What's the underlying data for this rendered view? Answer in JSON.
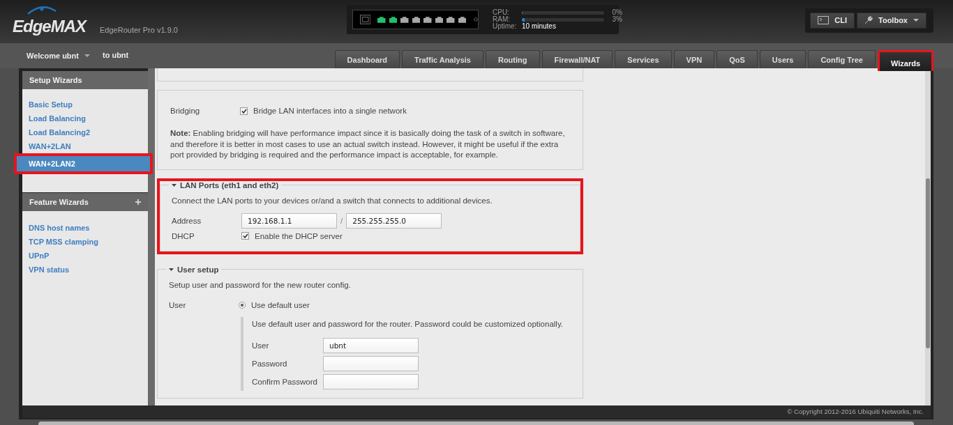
{
  "header": {
    "logo": "EdgeMAX",
    "product": "EdgeRouter Pro v1.9.0"
  },
  "ports": [
    {
      "active": true
    },
    {
      "active": true
    },
    {
      "active": false
    },
    {
      "active": false
    },
    {
      "active": false
    },
    {
      "active": false
    },
    {
      "active": false
    },
    {
      "active": false
    }
  ],
  "stats": [
    {
      "label": "CPU:",
      "level": 0,
      "reading": "0%"
    },
    {
      "label": "RAM:",
      "level": 0.03,
      "reading": "3%"
    }
  ],
  "uptime": {
    "label": "Uptime:",
    "value": "10 minutes"
  },
  "tools": [
    {
      "kind": "terminal",
      "label": "CLI",
      "dropdown": false
    },
    {
      "kind": "wrench",
      "label": "Toolbox",
      "dropdown": true
    }
  ],
  "user_menu": {
    "label": "Welcome ubnt",
    "target": "to ubnt"
  },
  "tabs": [
    {
      "label": "Dashboard",
      "selected": false,
      "highlighted": false
    },
    {
      "label": "Traffic Analysis",
      "selected": false,
      "highlighted": false
    },
    {
      "label": "Routing",
      "selected": false,
      "highlighted": false
    },
    {
      "label": "Firewall/NAT",
      "selected": false,
      "highlighted": false
    },
    {
      "label": "Services",
      "selected": false,
      "highlighted": false
    },
    {
      "label": "VPN",
      "selected": false,
      "highlighted": false
    },
    {
      "label": "QoS",
      "selected": false,
      "highlighted": false
    },
    {
      "label": "Users",
      "selected": false,
      "highlighted": false
    },
    {
      "label": "Config Tree",
      "selected": false,
      "highlighted": false
    },
    {
      "label": "Wizards",
      "selected": true,
      "highlighted": true
    }
  ],
  "sidebar": {
    "sections": [
      {
        "title": "Setup Wizards",
        "expandable": false,
        "items": [
          {
            "label": "Basic Setup",
            "selected": false,
            "highlighted": false
          },
          {
            "label": "Load Balancing",
            "selected": false,
            "highlighted": false
          },
          {
            "label": "Load Balancing2",
            "selected": false,
            "highlighted": false
          },
          {
            "label": "WAN+2LAN",
            "selected": false,
            "highlighted": false
          },
          {
            "label": "WAN+2LAN2",
            "selected": true,
            "highlighted": true
          }
        ]
      },
      {
        "title": "Feature Wizards",
        "expandable": true,
        "items": [
          {
            "label": "DNS host names",
            "selected": false,
            "highlighted": false
          },
          {
            "label": "TCP MSS clamping",
            "selected": false,
            "highlighted": false
          },
          {
            "label": "UPnP",
            "selected": false,
            "highlighted": false
          },
          {
            "label": "VPN status",
            "selected": false,
            "highlighted": false
          }
        ]
      }
    ]
  },
  "bridging": {
    "label": "Bridging",
    "checked": true,
    "option": "Bridge LAN interfaces into a single network",
    "note": "**Note:** Enabling bridging will have performance impact since it is basically doing the task of a switch in software, and therefore it is better in most cases to use an actual switch instead. However, it might be useful if the extra port provided by bridging is required and the performance impact is acceptable, for example."
  },
  "lan_ports": {
    "legend": "LAN Ports (eth1 and eth2)",
    "expanded": true,
    "highlighted": true,
    "description": "Connect the LAN ports to your devices or/and a switch that connects to additional devices.",
    "address": {
      "label": "Address",
      "ip": "192.168.1.1",
      "separator": "/",
      "netmask": "255.255.255.0"
    },
    "dhcp": {
      "label": "DHCP",
      "checked": true,
      "option": "Enable the DHCP server"
    }
  },
  "user_setup": {
    "legend": "User setup",
    "expanded": true,
    "description": "Setup user and password for the new router config.",
    "label": "User",
    "option": {
      "label": "Use default user",
      "selected": true
    },
    "hint": "Use default user and password for the router. Password could be customized optionally.",
    "fields": [
      {
        "label": "User",
        "value": "ubnt"
      },
      {
        "label": "Password"
      },
      {
        "label": "Confirm Password"
      }
    ]
  },
  "footer": "© Copyright 2012-2016 Ubiquiti Networks, Inc."
}
